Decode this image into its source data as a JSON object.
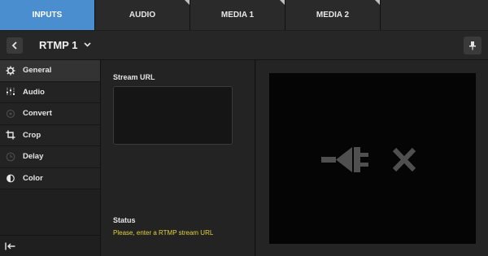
{
  "tabs": [
    {
      "label": "INPUTS",
      "active": true
    },
    {
      "label": "AUDIO"
    },
    {
      "label": "MEDIA 1"
    },
    {
      "label": "MEDIA 2"
    }
  ],
  "header": {
    "title": "RTMP 1"
  },
  "sidebar": {
    "items": [
      {
        "label": "General",
        "icon": "gear-icon"
      },
      {
        "label": "Audio",
        "icon": "sliders-icon"
      },
      {
        "label": "Convert",
        "icon": "convert-icon"
      },
      {
        "label": "Crop",
        "icon": "crop-icon"
      },
      {
        "label": "Delay",
        "icon": "clock-icon"
      },
      {
        "label": "Color",
        "icon": "color-drop-icon"
      }
    ]
  },
  "general": {
    "stream_url_label": "Stream URL",
    "stream_url_value": "",
    "status_label": "Status",
    "status_message": "Please, enter a RTMP stream URL"
  },
  "colors": {
    "active_tab": "#4a8ed0",
    "status_text": "#e3d13a"
  }
}
